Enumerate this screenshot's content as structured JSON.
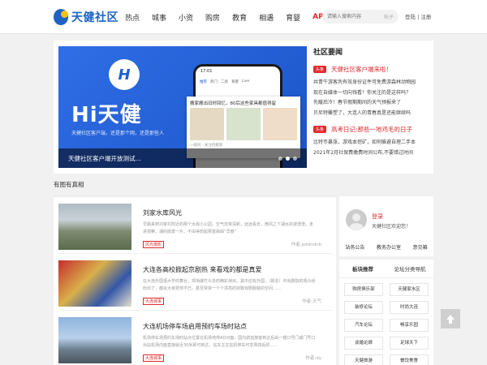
{
  "brand": {
    "name": "天健社区",
    "color": "#1e63c4"
  },
  "nav": {
    "items": [
      "热点",
      "城事",
      "小资",
      "购房",
      "教育",
      "相遇",
      "育婴",
      "APP"
    ]
  },
  "search": {
    "placeholder": "请输入搜索内容",
    "button": "帖子"
  },
  "auth": {
    "links": "登陆 | 注册"
  },
  "hero": {
    "banner": {
      "logo_letter": "H",
      "title": "Hi天健",
      "subtitle": "天健社区客户端，还是那个网，还是那些人",
      "phone_time": "17:01",
      "phone_tabs": [
        "推荐",
        "热门",
        "二房",
        "育婴",
        "Live"
      ],
      "card_title": "搬家搬出旧时回忆，80后这些家具都值得留",
      "card_foot": "一般同 · 关注的搬家",
      "caption": "天健社区客户端开放测试..."
    },
    "news": {
      "heading": "社区要闻",
      "items": [
        {
          "tag": "头条",
          "title": "天健社区客户端来啦！",
          "lines": [
            "共青牛游客凭有效身份证件可免费游森林动物园",
            "现在自媒体一切向钱看！你关注的是这样吗？",
            "先暖后冷！春节假期期间的天气预报来了",
            "贝尼特雕塑了，大连人的青春真是还能继续吗"
          ]
        },
        {
          "tag": "头条",
          "title": "高考日记:那些一地鸡毛的日子",
          "lines": [
            "比特币暴涨，游戏本挖矿，如何躲避自理二手本",
            "2021年2月社保费缴费时间公布,不要错过时间"
          ]
        }
      ]
    }
  },
  "articles": {
    "heading": "有图有真相",
    "items": [
      {
        "title": "刘家水库风光",
        "desc": "早晨来到刘家村附近的那个水库小公园，空气非常清新，远远看去，微风之下湖水的波澄澄，走进观察，湖的底景一片。不由得想起那首歌曲“早春”",
        "tag": "风光摄影",
        "author": "作者:pddndnb"
      },
      {
        "title": "大连各高校掀起京剧热 来看戏的都是真爱",
        "desc": "在大连外国语大学的舞台，现场爆竹众多的精彩演出，其中还有外国，（报名）中戏剧院的观众纷纷出了，都会大家费劳不已，甚至常常一个个漂亮的别致戏剧服装的空间……",
        "tag": "大连城事",
        "author": "作者:天气"
      },
      {
        "title": "大连机场停车场启用预约车场时站点",
        "desc": "机场停车场预约车场时站点位置在机场地停AD对面，国内航班旅客到达后由一楼口号门或门号口出站机场内面直接就近30米即可到达，站车主在站机停车可享周四后的……",
        "tag": "大连城事",
        "author": "作者:dy"
      }
    ]
  },
  "user_box": {
    "login": "登录",
    "welcome": "天健社区欢迎您！",
    "links": [
      "站务公告",
      "教务办公室",
      "意见箱"
    ]
  },
  "side_tabs": {
    "tabs": [
      "板块推荐",
      "论坛分类导航"
    ],
    "categories": [
      "购房俱乐部",
      "天健家水区",
      "装修论坛",
      "时尚大连",
      "汽车论坛",
      "畅享乐园",
      "谈婚论嫁",
      "足球天下",
      "天健旅游",
      "餐饮美食"
    ]
  }
}
